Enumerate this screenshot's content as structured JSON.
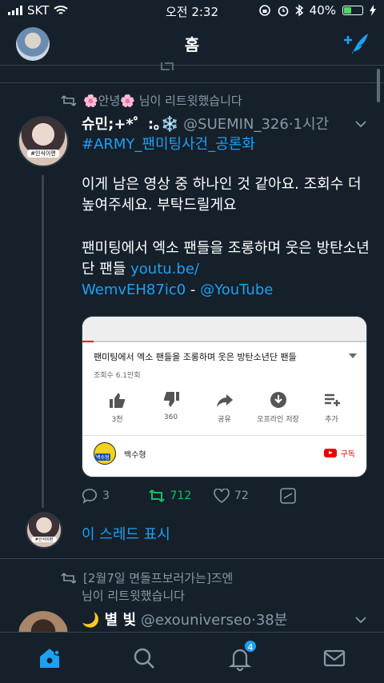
{
  "status": {
    "carrier": "SKT",
    "time": "오전 2:32",
    "battery": "40%"
  },
  "header": {
    "title": "홈"
  },
  "tweet1": {
    "retweet_by": "🌸안녕🌸 님이 리트윗했습니다",
    "display_name": "슈민;+*゜:｡❄️",
    "handle": "@SUEMIN_326",
    "time": "·1시간",
    "hashtag": "#ARMY_팬미팅사건_공론화",
    "para1": "이게 남은 영상 중 하나인 것 같아요. 조회수 더 높여주세요. 부탁드릴게요",
    "para2_text": "팬미팅에서 엑소 팬들을 조롱하며 웃은 방탄소년단 팬들",
    "link1": "youtu.be/",
    "link2": "WemvEH87ic0",
    "dash": " - ",
    "link3": "@YouTube",
    "avatar_tag": "#인식이편",
    "card": {
      "video_title": "팬미팅에서 엑소 팬들을 조롱하며 웃은 방탄소년단 팬들",
      "views": "조회수 6.1만회",
      "actions": [
        {
          "icon": "thumbs-up-icon",
          "label": "3천"
        },
        {
          "icon": "thumbs-down-icon",
          "label": "360"
        },
        {
          "icon": "share-icon",
          "label": "공유"
        },
        {
          "icon": "download-icon",
          "label": "오프라인 저장"
        },
        {
          "icon": "add-to-playlist-icon",
          "label": "추가"
        }
      ],
      "channel": "백수형",
      "channel_avatar_text": "백수형",
      "subscribe": "구독"
    },
    "stats": {
      "replies": "3",
      "retweets": "712",
      "likes": "72"
    },
    "retweet_color": "#17bf63"
  },
  "show_thread": "이 스레드 표시",
  "tweet2": {
    "retweet_line1": "[2월7일 면돌프보러가는]즈엔",
    "retweet_line2": "님이 리트윗했습니다",
    "display_name": "🌙 별 빛",
    "handle": "@exouniverseo",
    "time": "·38분"
  },
  "nav": {
    "notifications_badge": "4"
  },
  "colors": {
    "accent": "#1da1f2",
    "background": "#15202b",
    "secondary_text": "#8899a6"
  }
}
